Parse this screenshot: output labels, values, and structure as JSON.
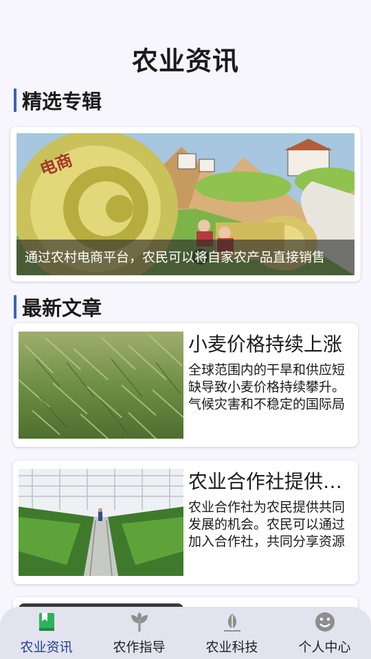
{
  "header": {
    "title": "农业资讯"
  },
  "sections": {
    "featured": "精选专辑",
    "latest": "最新文章"
  },
  "featured": {
    "caption": "通过农村电商平台，农民可以将自家农产品直接销售",
    "image_text": "电商"
  },
  "articles": [
    {
      "title": "小麦价格持续上涨",
      "summary": "全球范围内的干旱和供应短缺导致小麦价格持续攀升。气候灾害和不稳定的国际局势",
      "image": "wheat-field-photo"
    },
    {
      "title": "农业合作社提供共同发展机会",
      "summary": "农业合作社为农民提供共同发展的机会。农民可以通过加入合作社，共同分享资源",
      "image": "greenhouse-photo"
    }
  ],
  "bottom_nav": {
    "items": [
      {
        "label": "农业资讯",
        "icon": "book-icon",
        "active": true
      },
      {
        "label": "农作指导",
        "icon": "sprout-icon",
        "active": false
      },
      {
        "label": "农业科技",
        "icon": "plant-icon",
        "active": false
      },
      {
        "label": "个人中心",
        "icon": "smiley-icon",
        "active": false
      }
    ]
  },
  "colors": {
    "accent": "#3a63b3",
    "active_nav": "#1e3f9c",
    "active_icon": "#2fb25a",
    "inactive_icon": "#8e8e8e"
  }
}
